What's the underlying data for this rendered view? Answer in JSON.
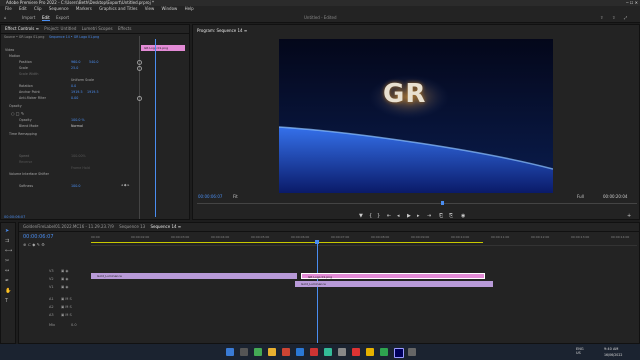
{
  "title_bar": {
    "title": "Adobe Premiere Pro 2022 - C:\\Users\\Beth\\Desktop\\Export\\Untitled.prproj *",
    "window_controls": "─  ☐  ✕"
  },
  "menu": [
    "File",
    "Edit",
    "Clip",
    "Sequence",
    "Markers",
    "Graphics and Titles",
    "View",
    "Window",
    "Help"
  ],
  "workspaces": {
    "import": "Import",
    "edit": "Edit",
    "export": "Export",
    "center": "Untitled  -  Edited"
  },
  "effect_controls": {
    "tabs": [
      "Effect Controls ≡",
      "Project: Untitled",
      "Lumetri Scopes",
      "Effects"
    ],
    "source": "Source • GR Logo 01.png",
    "sequence": "Sequence 14 • GR Logo 01.png",
    "clip_label": "GR Logo 01.png",
    "section_video": "Video",
    "section_motion": "Motion",
    "position_label": "Position",
    "position_x": "960.0",
    "position_y": "540.0",
    "scale_label": "Scale",
    "scale_val": "25.0",
    "scale_width_label": "Scale Width",
    "uniform_scale": "Uniform Scale",
    "rotation_label": "Rotation",
    "rotation_val": "0.0",
    "anchor_label": "Anchor Point",
    "anchor_x": "1919.5",
    "anchor_y": "1919.5",
    "antiflicker_label": "Anti-flicker Filter",
    "antiflicker_val": "0.00",
    "opacity_section": "Opacity",
    "opacity_label": "Opacity",
    "opacity_val": "100.0 %",
    "blend_label": "Blend Mode",
    "blend_val": "Normal",
    "time_remap": "Time Remapping",
    "speed_label": "Speed",
    "speed_val": "100.00%",
    "reverse_label": "Reverse",
    "interp_label": "Frame Hold",
    "volume_section": "Volume Interface Shifter",
    "volume_label": "Softness",
    "volume_val": "100.0",
    "timecode": "00:00:06:07"
  },
  "program": {
    "tab": "Program: Sequence 14  ≡",
    "overlay_text": "GR",
    "timecode_left": "00:00:06:07",
    "fit": "Fit",
    "full": "Full",
    "timecode_right": "00:00:20:04"
  },
  "timeline": {
    "tabs": [
      "GoldenFireLabel01.2022.MC16 - 11.29.23.7/9",
      "Sequence 13",
      "Sequence 14  ≡"
    ],
    "timecode": "00:00:06:07",
    "ruler": [
      "00:00",
      "00:00:02:00",
      "00:00:03:00",
      "00:00:04:00",
      "00:00:05:00",
      "00:00:06:00",
      "00:00:07:00",
      "00:00:08:00",
      "00:00:09:00",
      "00:00:10:00",
      "00:00:11:00",
      "00:00:12:00",
      "00:00:13:00",
      "00:00:14:00"
    ],
    "tracks": [
      "V3",
      "V2",
      "V1",
      "A1",
      "A2",
      "A3",
      "Mix"
    ],
    "mix_val": "0.0",
    "clips": [
      {
        "label": "Gold_Luminance",
        "color": "#b89ad8"
      },
      {
        "label": "GR Logo 01.png",
        "color": "#e38bd6"
      },
      {
        "label": "Gold_Luminance",
        "color": "#b89ad8"
      }
    ]
  },
  "taskbar": {
    "time": "9:40 AM",
    "date": "16/06/2022",
    "lang": "ENG\nUS"
  }
}
